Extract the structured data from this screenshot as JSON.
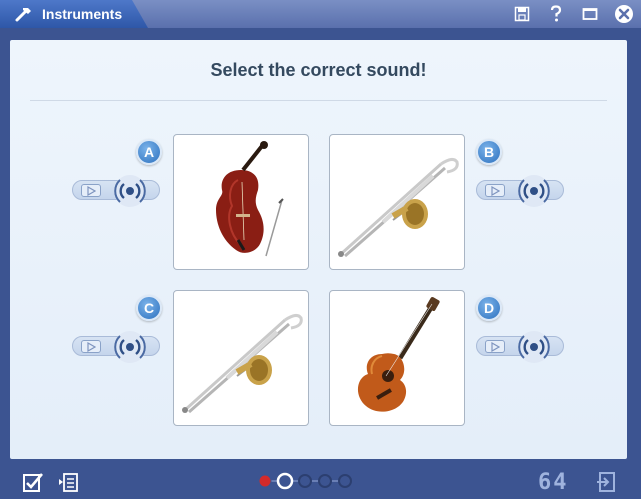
{
  "window": {
    "title": "Instruments",
    "controls": [
      "save-icon",
      "help-icon",
      "maximize-icon",
      "close-icon"
    ]
  },
  "quiz": {
    "heading": "Select the correct sound!",
    "options": [
      {
        "letter": "A",
        "image": "double-bass-with-bow"
      },
      {
        "letter": "B",
        "image": "trombone"
      },
      {
        "letter": "C",
        "image": "trombone"
      },
      {
        "letter": "D",
        "image": "acoustic-guitar"
      }
    ]
  },
  "footer": {
    "pagination": {
      "total": 5,
      "current_index": 1,
      "completed_index": 0
    },
    "counter": "64"
  },
  "colors": {
    "frame": "#3c5491",
    "title_tab": "#3a63b7",
    "badge": "#2d71be",
    "heading_text": "#34495f",
    "active_dot": "#d42a2a"
  }
}
